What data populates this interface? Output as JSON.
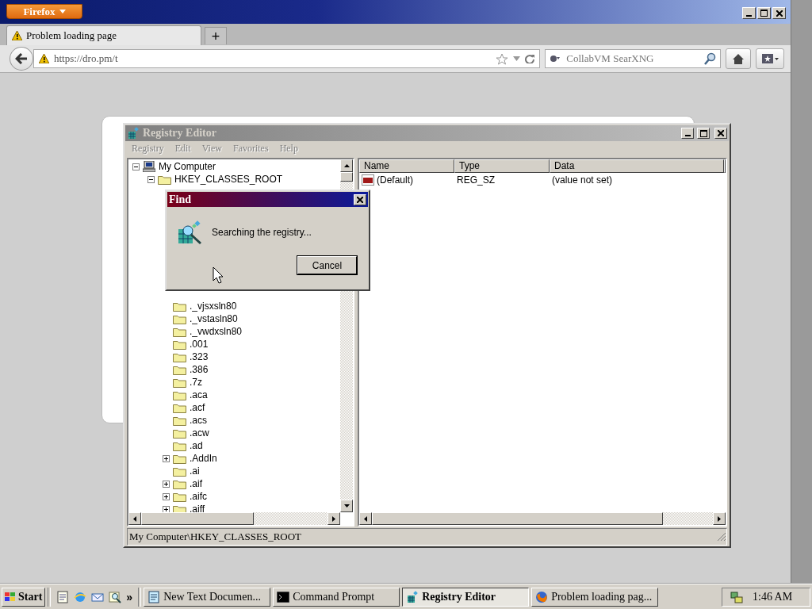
{
  "browser": {
    "menu_button": "Firefox",
    "tabs": [
      {
        "title": "Problem loading page",
        "selected": true
      }
    ],
    "new_tab": "+",
    "url": "https://dro.pm/t",
    "search_placeholder": "CollabVM SearXNG"
  },
  "regedit": {
    "title": "Registry Editor",
    "active": false,
    "menu": [
      {
        "label": "Registry",
        "disabled": true
      },
      {
        "label": "Edit",
        "disabled": true
      },
      {
        "label": "View",
        "disabled": true
      },
      {
        "label": "Favorites",
        "disabled": true
      },
      {
        "label": "Help",
        "disabled": true
      }
    ],
    "tree": [
      {
        "label": "My Computer",
        "kind": "computer",
        "expanded": true,
        "children": [
          {
            "label": "HKEY_CLASSES_ROOT",
            "kind": "folder",
            "expanded": true,
            "children": [
              {
                "label": "._vjsxsln80",
                "kind": "folder"
              },
              {
                "label": "._vstasln80",
                "kind": "folder"
              },
              {
                "label": "._vwdxsln80",
                "kind": "folder"
              },
              {
                "label": ".001",
                "kind": "folder"
              },
              {
                "label": ".323",
                "kind": "folder"
              },
              {
                "label": ".386",
                "kind": "folder"
              },
              {
                "label": ".7z",
                "kind": "folder"
              },
              {
                "label": ".aca",
                "kind": "folder"
              },
              {
                "label": ".acf",
                "kind": "folder"
              },
              {
                "label": ".acs",
                "kind": "folder"
              },
              {
                "label": ".acw",
                "kind": "folder"
              },
              {
                "label": ".ad",
                "kind": "folder"
              },
              {
                "label": ".AddIn",
                "kind": "folder",
                "expanded": false
              },
              {
                "label": ".ai",
                "kind": "folder"
              },
              {
                "label": ".aif",
                "kind": "folder",
                "expanded": false
              },
              {
                "label": ".aifc",
                "kind": "folder",
                "expanded": false
              },
              {
                "label": ".aiff",
                "kind": "folder",
                "expanded": false
              }
            ]
          }
        ]
      }
    ],
    "columns": [
      "Name",
      "Type",
      "Data"
    ],
    "rows": [
      {
        "name": "(Default)",
        "type": "REG_SZ",
        "data": "(value not set)"
      }
    ],
    "status": "My Computer\\HKEY_CLASSES_ROOT"
  },
  "find_dialog": {
    "title": "Find",
    "message": "Searching the registry...",
    "button": "Cancel"
  },
  "taskbar": {
    "start": "Start",
    "overflow": "»",
    "tasks": [
      {
        "label": "New Text Documen...",
        "kind": "notepad",
        "selected": false
      },
      {
        "label": "Command Prompt",
        "kind": "console",
        "selected": false
      },
      {
        "label": "Registry Editor",
        "kind": "regedit",
        "selected": true
      },
      {
        "label": "Problem loading pag...",
        "kind": "firefox",
        "selected": false
      }
    ],
    "clock": "1:46 AM"
  }
}
